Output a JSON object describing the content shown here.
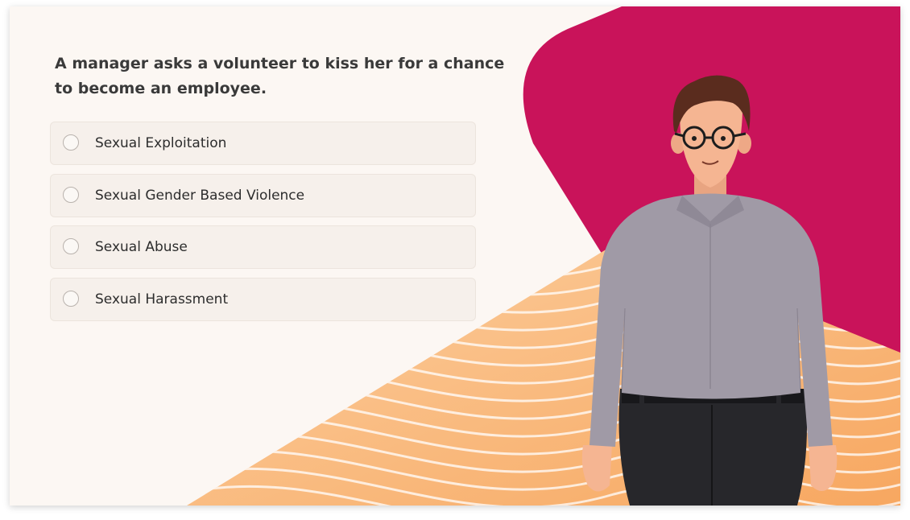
{
  "question": {
    "text": "A manager asks a volunteer to kiss her for a chance to become an employee."
  },
  "options": [
    {
      "label": "Sexual Exploitation",
      "selected": false
    },
    {
      "label": "Sexual Gender Based Violence",
      "selected": false
    },
    {
      "label": "Sexual Abuse",
      "selected": false
    },
    {
      "label": "Sexual Harassment",
      "selected": false
    }
  ],
  "colors": {
    "background": "#fcf7f3",
    "accent_pink": "#c9135a",
    "wave_orange": "#f9bf86",
    "text": "#3a3a3a"
  }
}
